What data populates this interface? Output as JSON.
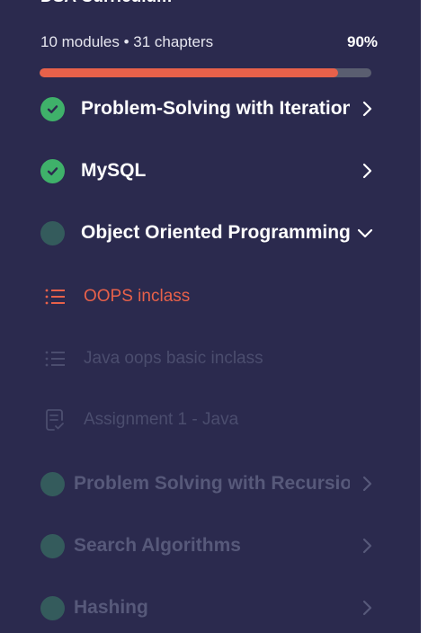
{
  "curriculum": {
    "title": "DSA Curriculum",
    "stats": "10 modules • 31 chapters",
    "progress_label": "90%",
    "progress": 0.9
  },
  "modules": [
    {
      "title": "Problem-Solving with Iterations",
      "status": "completed",
      "icon": "chevron-right-icon"
    },
    {
      "title": "MySQL",
      "status": "completed",
      "icon": "chevron-right-icon"
    },
    {
      "title": "Object Oriented Programming",
      "status": "in-progress",
      "icon": "chevron-down-icon"
    },
    {
      "title": "Problem Solving with Recursion",
      "status": "locked",
      "icon": "chevron-right-icon"
    },
    {
      "title": "Search Algorithms",
      "status": "locked",
      "icon": "chevron-right-icon"
    },
    {
      "title": "Hashing",
      "status": "locked",
      "icon": "chevron-right-icon"
    }
  ],
  "chapters": [
    {
      "label": "OOPS inclass",
      "state": "active",
      "icon": "list-icon"
    },
    {
      "label": "Java oops basic inclass",
      "state": "locked",
      "icon": "list-icon"
    },
    {
      "label": "Assignment 1 - Java",
      "state": "locked",
      "icon": "assignment-icon"
    }
  ],
  "colors": {
    "panel_bg": "#2b2a4e",
    "accent": "#e8614a",
    "completed": "#3fb16a",
    "pending": "#345b5c",
    "dim_text": "#57597a"
  }
}
